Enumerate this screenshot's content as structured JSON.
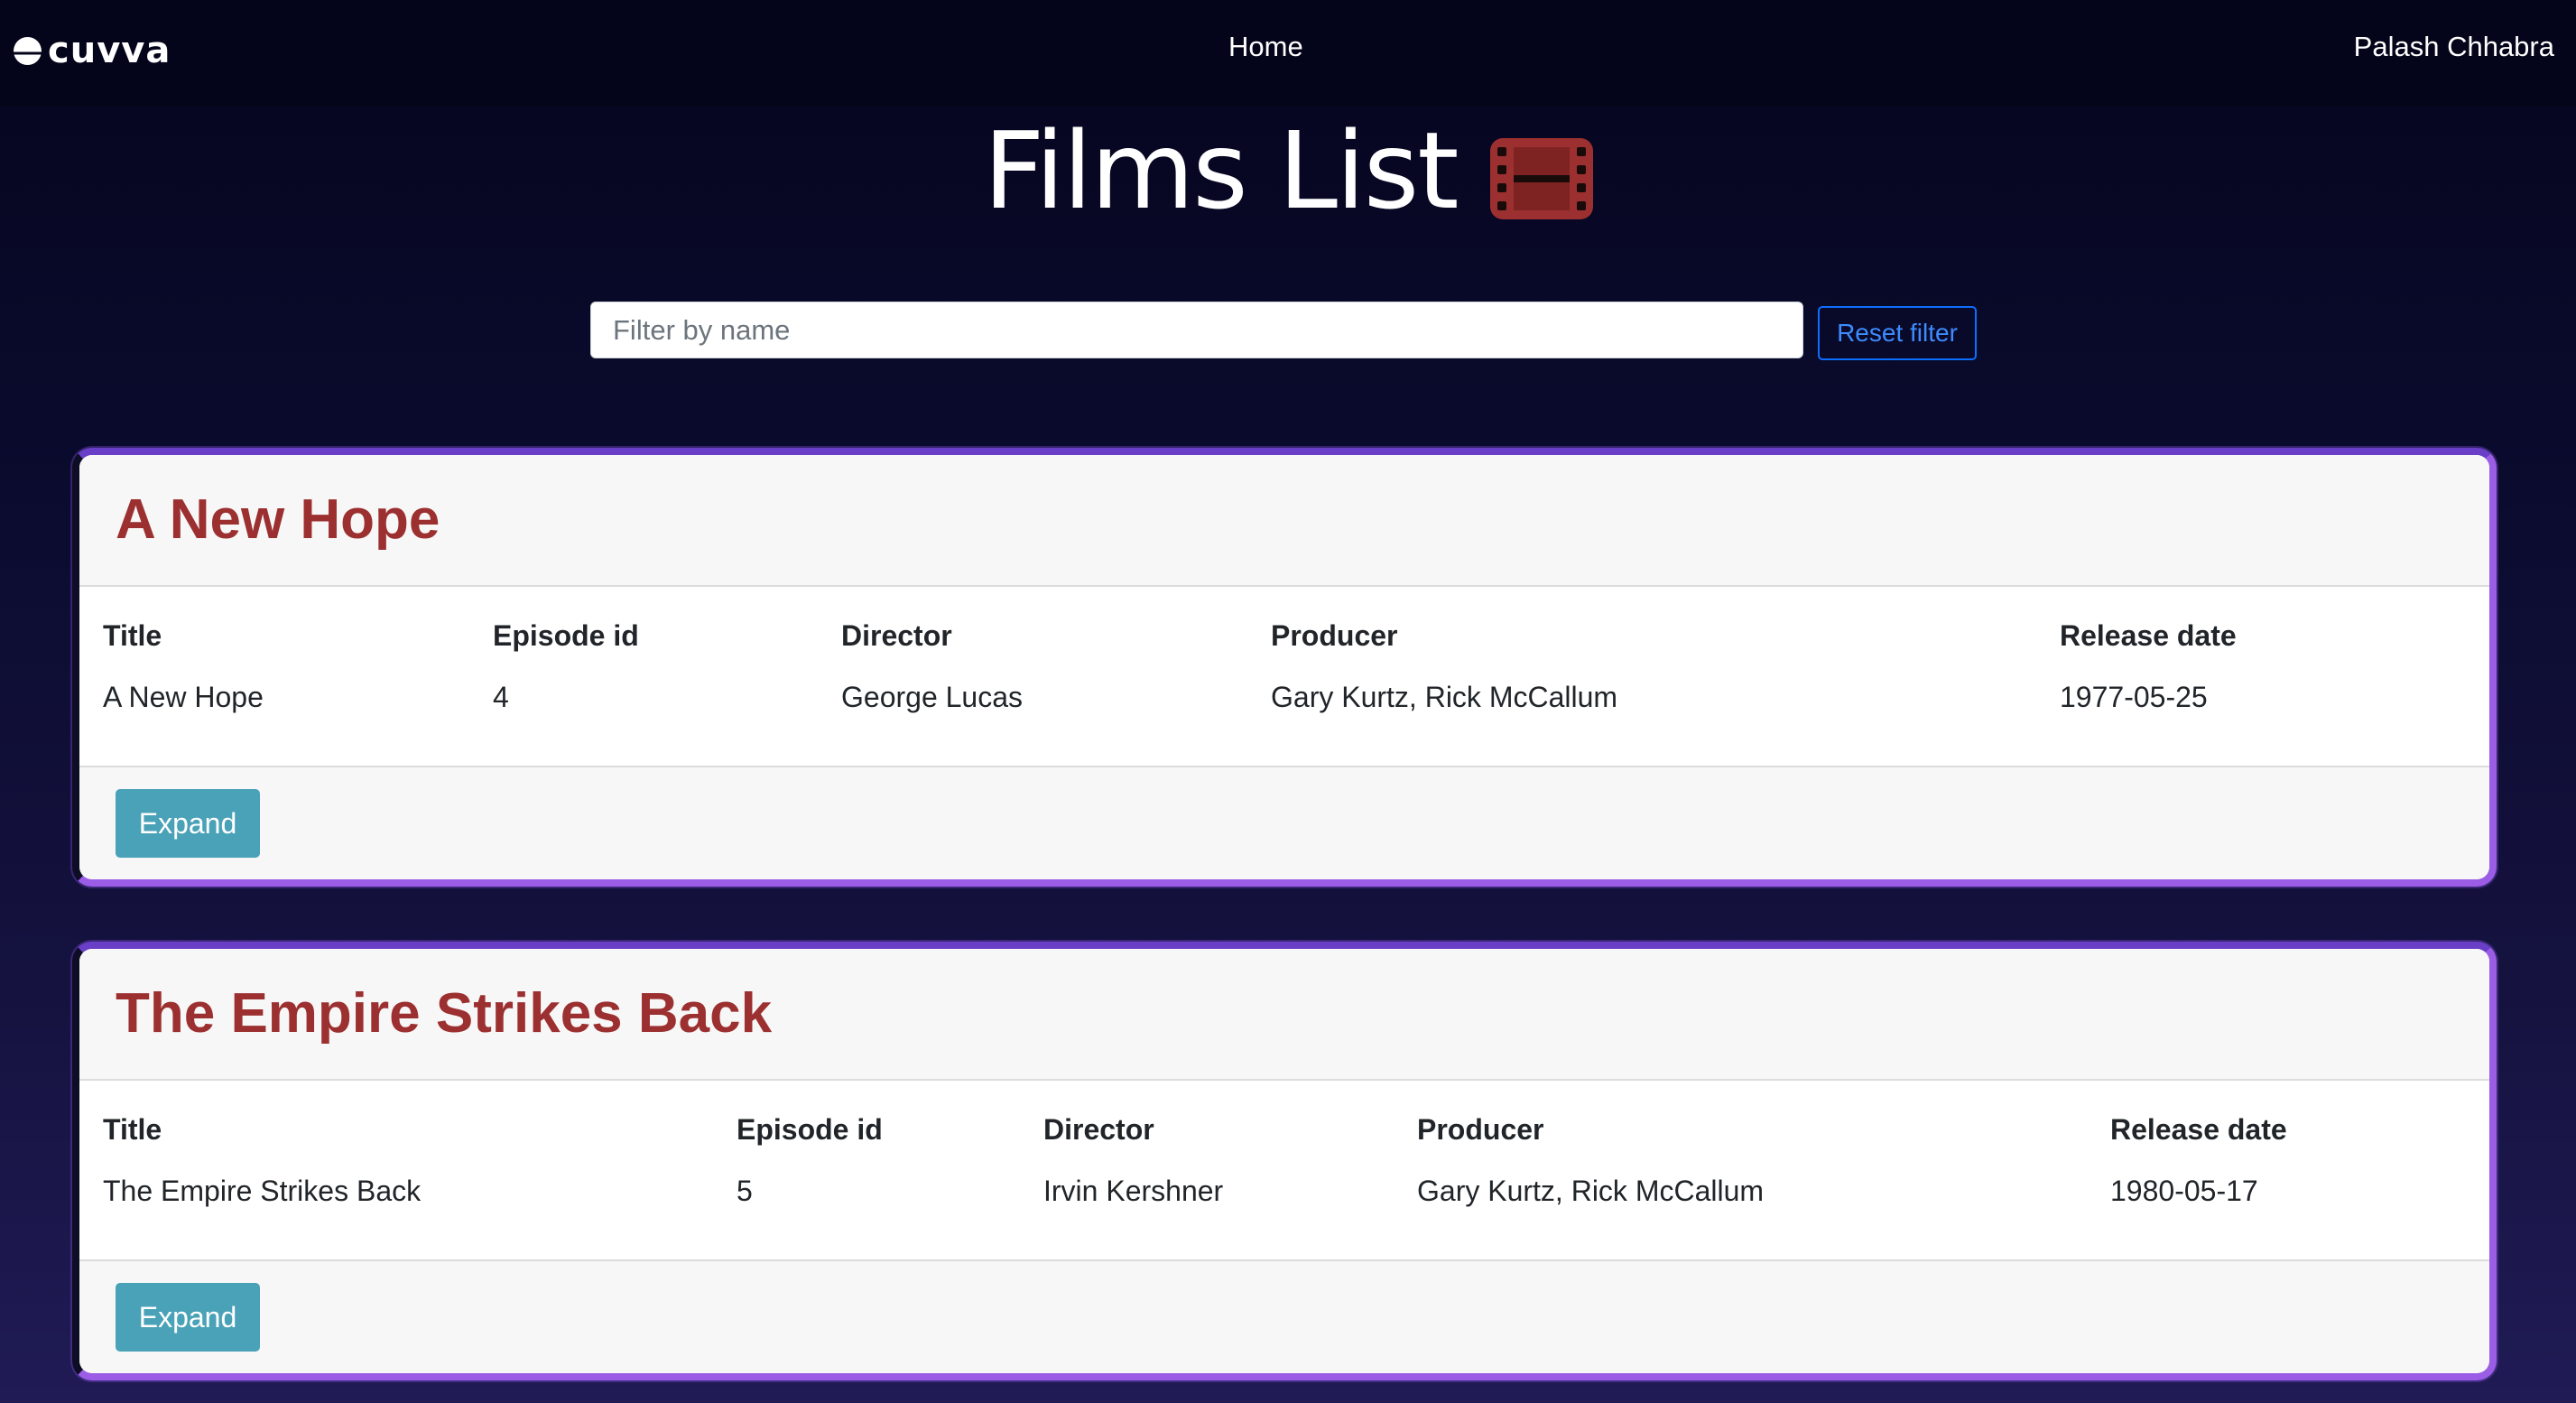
{
  "header": {
    "logo_text": "cuvva",
    "nav_home": "Home",
    "user_name": "Palash Chhabra"
  },
  "page": {
    "title": "Films List",
    "title_icon": "film-icon",
    "title_icon_color": "#9c3030"
  },
  "filter": {
    "placeholder": "Filter by name",
    "value": "",
    "reset_label": "Reset filter"
  },
  "columns": {
    "title": "Title",
    "episode_id": "Episode id",
    "director": "Director",
    "producer": "Producer",
    "release_date": "Release date"
  },
  "films": [
    {
      "heading": "A New Hope",
      "title": "A New Hope",
      "episode_id": "4",
      "director": "George Lucas",
      "producer": "Gary Kurtz, Rick McCallum",
      "release_date": "1977-05-25",
      "expand_label": "Expand"
    },
    {
      "heading": "The Empire Strikes Back",
      "title": "The Empire Strikes Back",
      "episode_id": "5",
      "director": "Irvin Kershner",
      "producer": "Gary Kurtz, Rick McCallum",
      "release_date": "1980-05-17",
      "expand_label": "Expand"
    }
  ],
  "colors": {
    "accent_border": "#9b5de5",
    "heading_red": "#9c3030",
    "expand_button": "#4aa2b8",
    "reset_button": "#0d6efd"
  }
}
